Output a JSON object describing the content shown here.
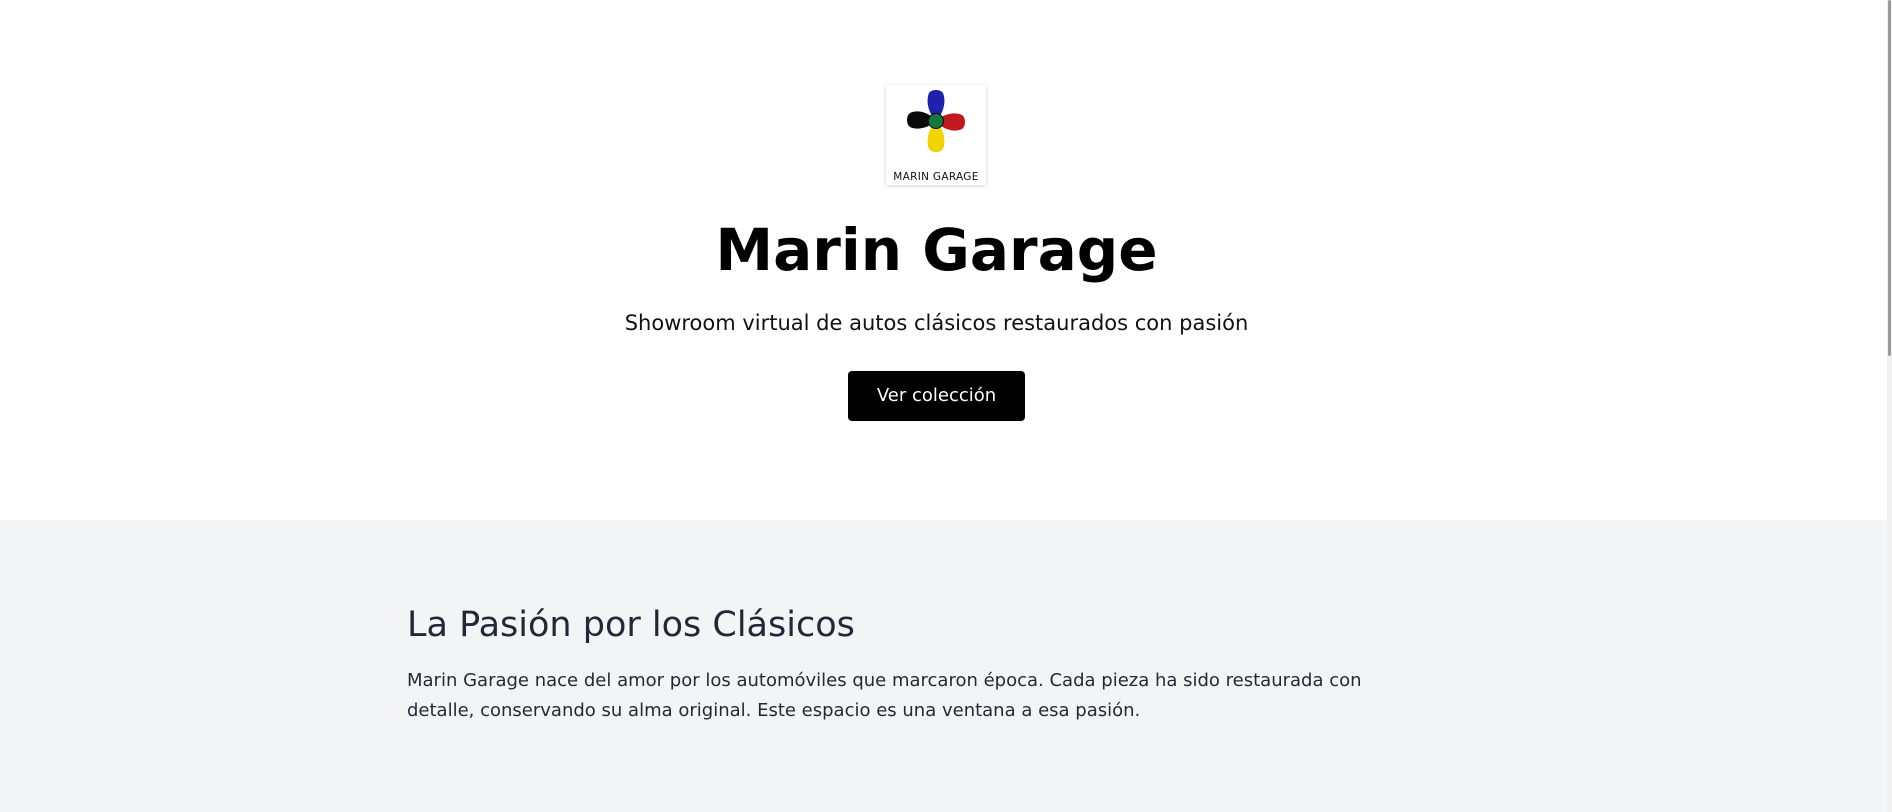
{
  "hero": {
    "logo": {
      "icon": "four-petal-logo-icon",
      "text": "MARIN GARAGE",
      "colors": {
        "top": "#1f1fb0",
        "right": "#c0181c",
        "bottom": "#f2d400",
        "left": "#0a0a0a",
        "center": "#137a3a"
      }
    },
    "title": "Marin Garage",
    "subtitle": "Showroom virtual de autos clásicos restaurados con pasión",
    "cta_label": "Ver colección"
  },
  "about": {
    "title": "La Pasión por los Clásicos",
    "text": "Marin Garage nace del amor por los automóviles que marcaron época. Cada pieza ha sido restaurada con detalle, conservando su alma original. Este espacio es una ventana a esa pasión."
  },
  "theme": {
    "hero_background": "#ffffff",
    "about_background": "#f3f4f6",
    "button_background": "#000000",
    "button_text": "#ffffff",
    "heading_text": "#1f2937"
  }
}
